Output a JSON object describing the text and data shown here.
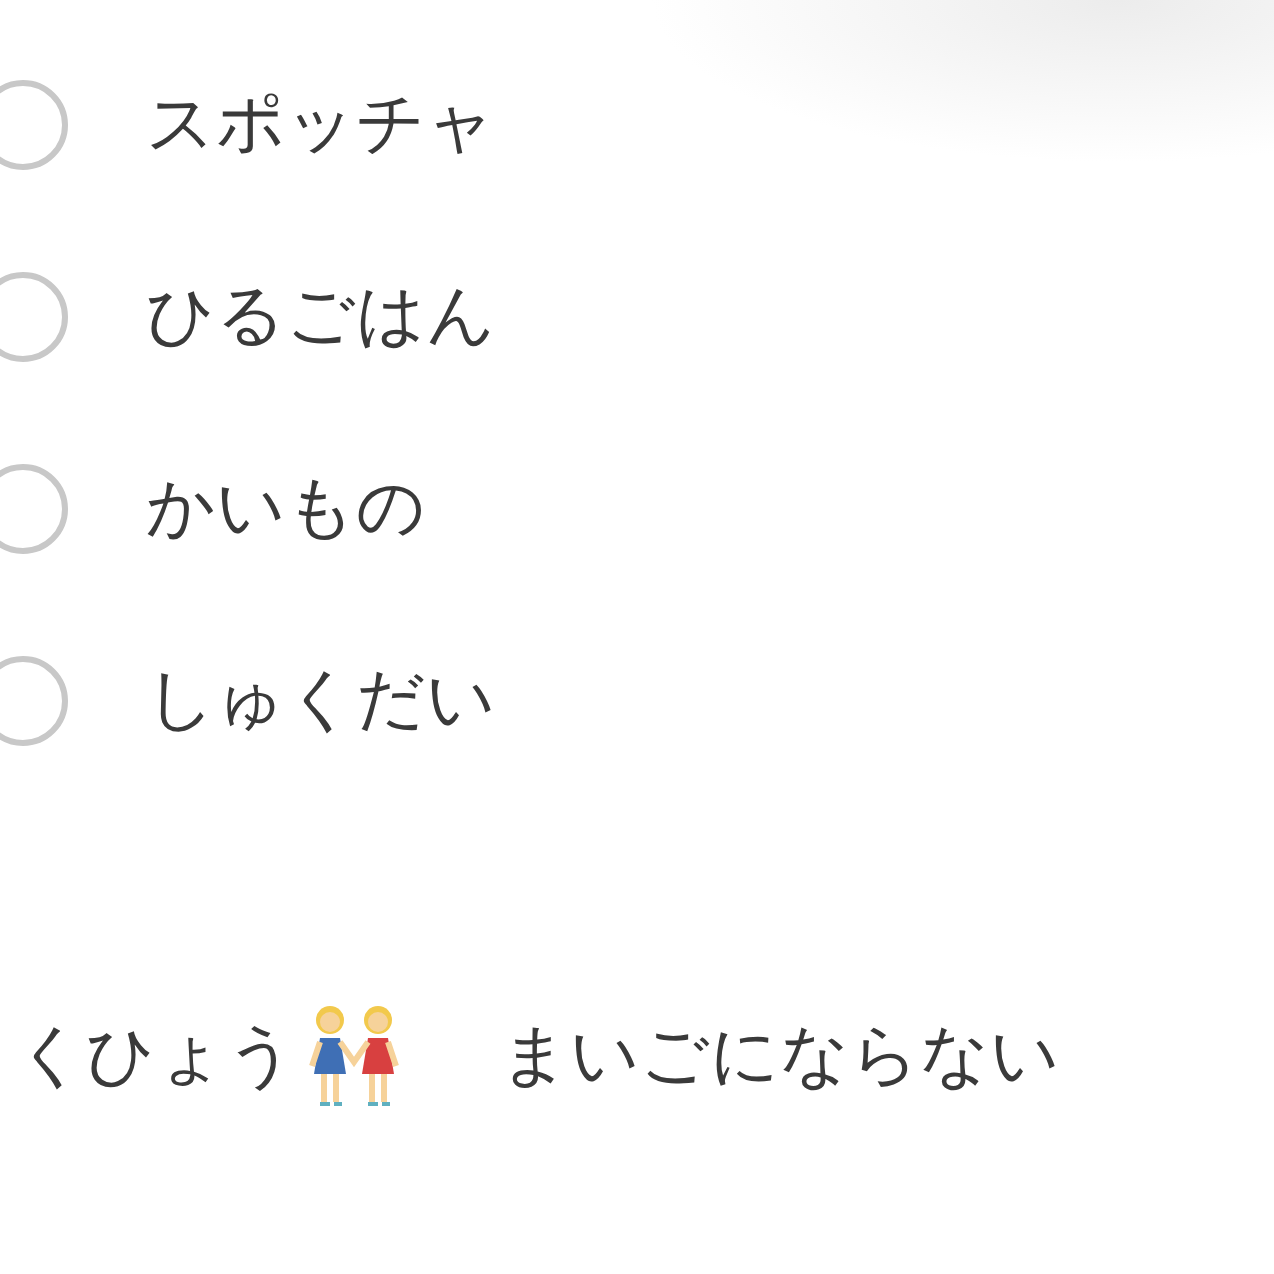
{
  "tasks": [
    {
      "label": "スポッチャ",
      "checked": false
    },
    {
      "label": "ひるごはん",
      "checked": false
    },
    {
      "label": "かいもの",
      "checked": false
    },
    {
      "label": "しゅくだい",
      "checked": false
    }
  ],
  "footer": {
    "goal": "くひょう",
    "note": "まいごにならない"
  }
}
